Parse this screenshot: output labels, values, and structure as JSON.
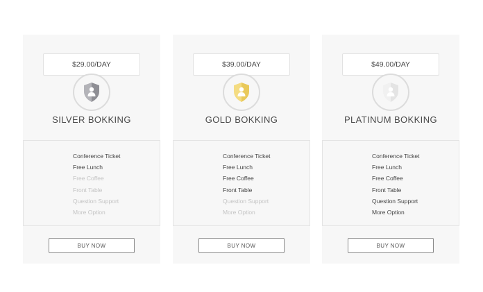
{
  "plans": [
    {
      "price": "$29.00/DAY",
      "name": "SILVER BOKKING",
      "icon": "silver-shield-user-icon",
      "icon_colors": {
        "left": "#b3b3b8",
        "right": "#8f8f95",
        "person": "#ffffff"
      },
      "features": [
        {
          "label": "Conference Ticket",
          "included": true
        },
        {
          "label": "Free Lunch",
          "included": true
        },
        {
          "label": "Free Coffee",
          "included": false
        },
        {
          "label": "Front Table",
          "included": false
        },
        {
          "label": "Question Support",
          "included": false
        },
        {
          "label": "More Option",
          "included": false
        }
      ],
      "button": "BUY NOW"
    },
    {
      "price": "$39.00/DAY",
      "name": "GOLD BOKKING",
      "icon": "gold-shield-user-icon",
      "icon_colors": {
        "left": "#f4dc82",
        "right": "#e9c95a",
        "person": "#ffffff"
      },
      "features": [
        {
          "label": "Conference Ticket",
          "included": true
        },
        {
          "label": "Free Lunch",
          "included": true
        },
        {
          "label": "Free Coffee",
          "included": true
        },
        {
          "label": "Front Table",
          "included": true
        },
        {
          "label": "Question Support",
          "included": false
        },
        {
          "label": "More Option",
          "included": false
        }
      ],
      "button": "BUY NOW"
    },
    {
      "price": "$49.00/DAY",
      "name": "PLATINUM BOKKING",
      "icon": "platinum-shield-user-icon",
      "icon_colors": {
        "left": "#f1f1f1",
        "right": "#e4e4e4",
        "person": "#ffffff"
      },
      "features": [
        {
          "label": "Conference Ticket",
          "included": true
        },
        {
          "label": "Free Lunch",
          "included": true
        },
        {
          "label": "Free Coffee",
          "included": true
        },
        {
          "label": "Front Table",
          "included": true
        },
        {
          "label": "Question Support",
          "included": true
        },
        {
          "label": "More Option",
          "included": true
        }
      ],
      "button": "BUY NOW"
    }
  ]
}
